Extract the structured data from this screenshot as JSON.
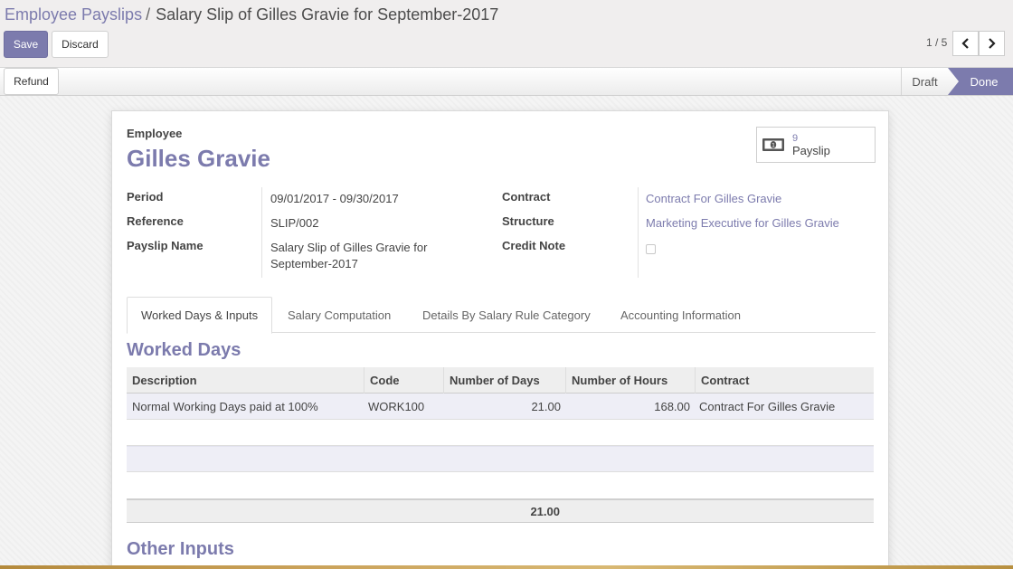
{
  "breadcrumb": {
    "parent": "Employee Payslips",
    "separator": "/",
    "current": "Salary Slip of Gilles Gravie for September-2017"
  },
  "toolbar": {
    "save_label": "Save",
    "discard_label": "Discard"
  },
  "pager": {
    "value": "1 / 5"
  },
  "statusbar": {
    "refund_label": "Refund",
    "stages": [
      "Draft",
      "Done"
    ],
    "active_stage": "Done"
  },
  "colors": {
    "accent": "#7c7bad"
  },
  "form": {
    "employee_label": "Employee",
    "employee_name": "Gilles Gravie",
    "smart_button": {
      "count": "9",
      "label": "Payslip",
      "icon": "money-icon"
    },
    "left_fields": [
      {
        "label": "Period",
        "value": "09/01/2017 - 09/30/2017"
      },
      {
        "label": "Reference",
        "value": "SLIP/002"
      },
      {
        "label": "Payslip Name",
        "value_line1": "Salary Slip of Gilles Gravie for",
        "value_line2": "September-2017"
      }
    ],
    "right_fields": [
      {
        "label": "Contract",
        "value": "Contract For Gilles Gravie"
      },
      {
        "label": "Structure",
        "value": "Marketing Executive for Gilles Gravie"
      },
      {
        "label": "Credit Note",
        "checked": false
      }
    ]
  },
  "tabs": [
    {
      "label": "Worked Days & Inputs",
      "active": true
    },
    {
      "label": "Salary Computation",
      "active": false
    },
    {
      "label": "Details By Salary Rule Category",
      "active": false
    },
    {
      "label": "Accounting Information",
      "active": false
    }
  ],
  "worked_days": {
    "title": "Worked Days",
    "columns": [
      "Description",
      "Code",
      "Number of Days",
      "Number of Hours",
      "Contract"
    ],
    "rows": [
      {
        "description": "Normal Working Days paid at 100%",
        "code": "WORK100",
        "days": "21.00",
        "hours": "168.00",
        "contract": "Contract For Gilles Gravie"
      }
    ],
    "total_days": "21.00"
  },
  "other_inputs": {
    "title": "Other Inputs"
  }
}
